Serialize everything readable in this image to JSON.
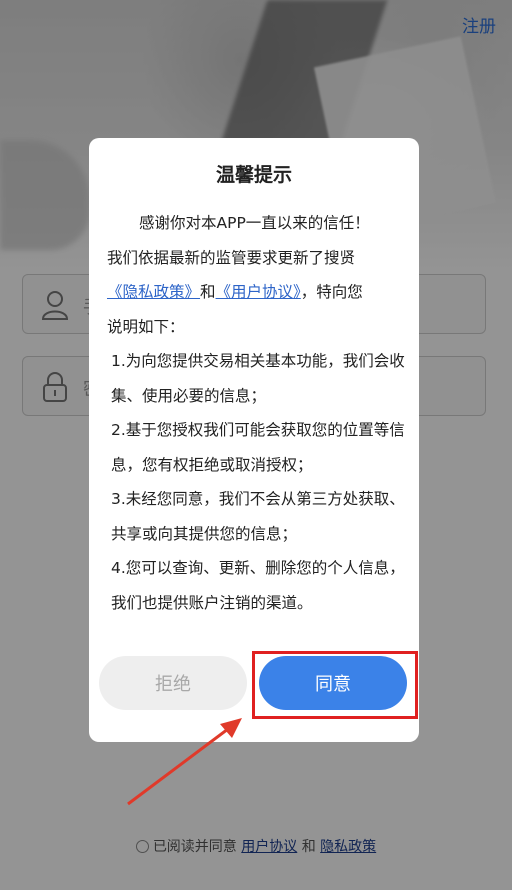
{
  "header": {
    "register_label": "注册"
  },
  "login": {
    "phone_placeholder": "手",
    "password_placeholder": "密"
  },
  "agreement": {
    "prefix": "已阅读并同意",
    "user_agreement": "用户协议",
    "and": "和",
    "privacy_policy": "隐私政策"
  },
  "dialog": {
    "title": "温馨提示",
    "intro": "感谢你对本APP一直以来的信任！",
    "line2": "我们依据最新的监管要求更新了搜贤",
    "privacy_link": "《隐私政策》",
    "and": "和",
    "user_link": "《用户协议》",
    "line3_tail": "，特向您",
    "line4": "说明如下：",
    "items": [
      "1.为向您提供交易相关基本功能，我们会收集、使用必要的信息；",
      "2.基于您授权我们可能会获取您的位置等信息，您有权拒绝或取消授权；",
      "3.未经您同意，我们不会从第三方处获取、共享或向其提供您的信息；",
      "4.您可以查询、更新、删除您的个人信息，我们也提供账户注销的渠道。"
    ],
    "reject_label": "拒绝",
    "agree_label": "同意"
  },
  "colors": {
    "accent": "#3b82e8",
    "link": "#2d64c8",
    "highlight": "#e02020"
  }
}
